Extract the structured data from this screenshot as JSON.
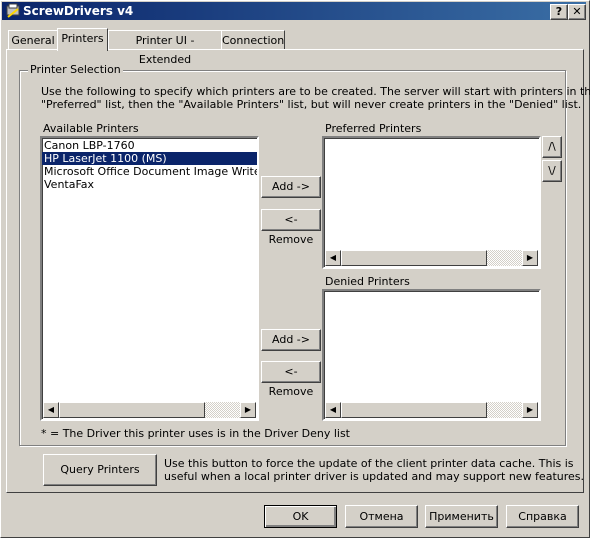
{
  "window": {
    "title": "ScrewDrivers v4",
    "help_btn": "?",
    "close_btn": "✕"
  },
  "tabs": [
    "General",
    "Printers",
    "Printer UI - Extended",
    "Connection"
  ],
  "group": {
    "label": "Printer Selection",
    "description_line1": "Use the following to specify which printers are to be created.  The server will start with printers in the",
    "description_line2": "\"Preferred\" list, then the \"Available Printers\" list, but will never create printers in the \"Denied\" list."
  },
  "available": {
    "label": "Available Printers",
    "items": [
      "Canon LBP-1760",
      "HP LaserJet 1100 (MS)",
      "Microsoft Office Document Image Writer",
      "VentaFax"
    ],
    "selected_index": 1
  },
  "preferred": {
    "label": "Preferred Printers",
    "items": []
  },
  "denied": {
    "label": "Denied Printers",
    "items": []
  },
  "buttons": {
    "add_preferred": "Add ->",
    "remove_preferred": "<- Remove",
    "add_denied": "Add ->",
    "remove_denied": "<- Remove",
    "move_up": "/\\",
    "move_down": "\\/",
    "query_printers": "Query Printers"
  },
  "note": "* = The Driver this printer uses is in the Driver Deny list",
  "query_help_line1": "Use this button to force the update of the client printer data cache.  This is",
  "query_help_line2": "useful when a local printer driver is updated and may support new features.",
  "footer": {
    "ok": "OK",
    "cancel": "Отмена",
    "apply": "Применить",
    "help": "Справка"
  }
}
